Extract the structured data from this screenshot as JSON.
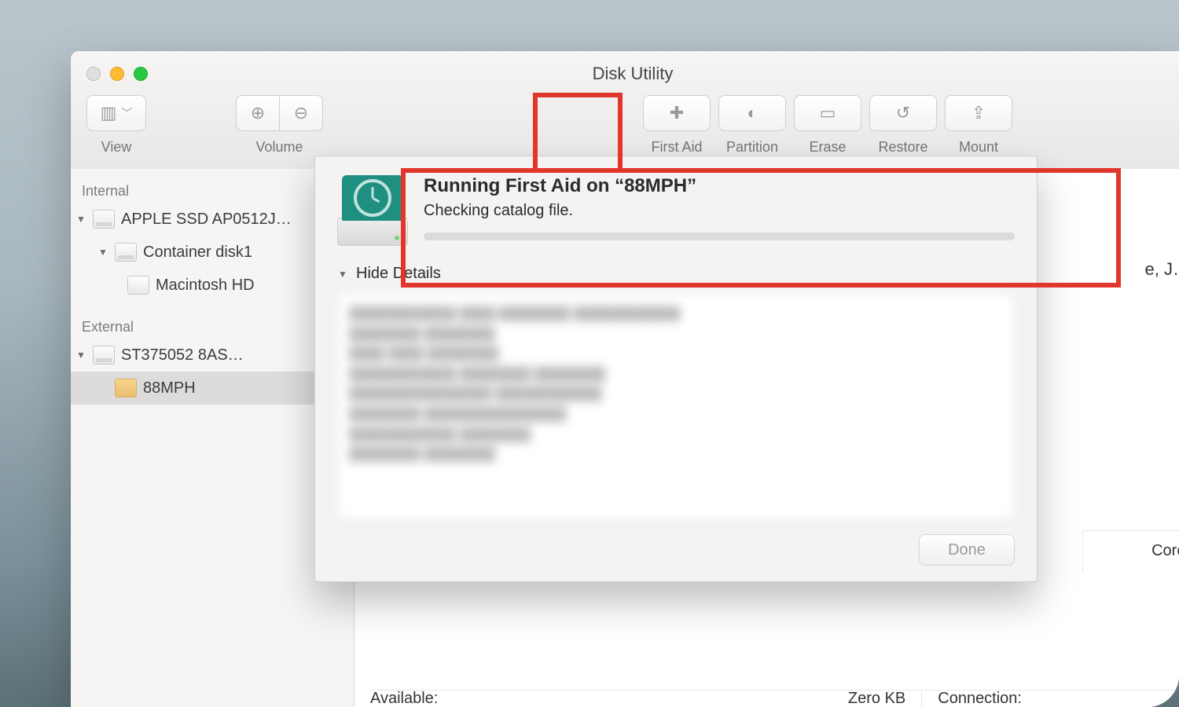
{
  "window": {
    "title": "Disk Utility"
  },
  "toolbar": {
    "view": {
      "label": "View"
    },
    "volume": {
      "label": "Volume"
    },
    "first_aid": {
      "label": "First Aid"
    },
    "partition": {
      "label": "Partition"
    },
    "erase": {
      "label": "Erase"
    },
    "restore": {
      "label": "Restore"
    },
    "mount": {
      "label": "Mount"
    }
  },
  "sidebar": {
    "internal_header": "Internal",
    "external_header": "External",
    "internal": [
      {
        "label": "APPLE SSD AP0512J…"
      },
      {
        "label": "Container disk1"
      },
      {
        "label": "Macintosh HD"
      }
    ],
    "external": [
      {
        "label": "ST375052 8AS…"
      },
      {
        "label": "88MPH"
      }
    ]
  },
  "sheet": {
    "title": "Running First Aid on “88MPH”",
    "subtitle": "Checking catalog file.",
    "details_toggle": "Hide Details",
    "done": "Done"
  },
  "behind": {
    "text1": "e, J…",
    "text2": "Core:"
  },
  "details": {
    "available_label": "Available:",
    "available_value": "Zero KB",
    "connection_label": "Connection:"
  }
}
